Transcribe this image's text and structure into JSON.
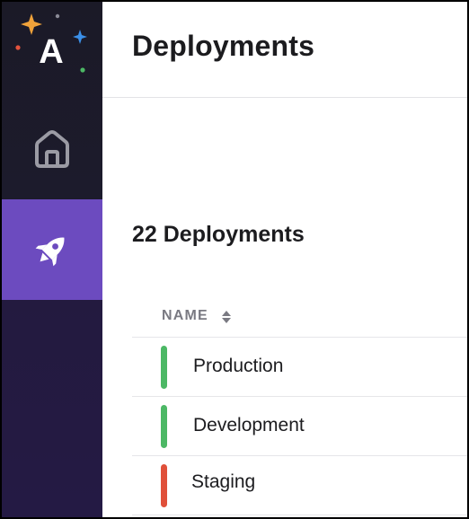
{
  "app": {
    "logo_letter": "A"
  },
  "sidebar": {
    "items": [
      {
        "icon": "home-icon",
        "active": false
      },
      {
        "icon": "rocket-icon",
        "active": true
      }
    ],
    "active_color": "#6c4bbf"
  },
  "header": {
    "title": "Deployments"
  },
  "section": {
    "title": "22 Deployments"
  },
  "table": {
    "columns": [
      {
        "label": "NAME",
        "sortable": true
      }
    ],
    "rows": [
      {
        "name": "Production",
        "status_color": "#4cb865"
      },
      {
        "name": "Development",
        "status_color": "#4cb865"
      },
      {
        "name": "Staging",
        "status_color": "#e0503a"
      }
    ]
  }
}
